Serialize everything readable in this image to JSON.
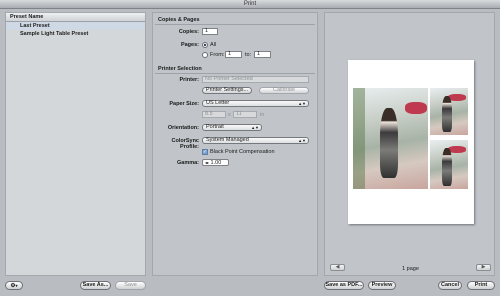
{
  "window": {
    "title": "Print"
  },
  "presets": {
    "header": "Preset Name",
    "items": [
      "Last Preset",
      "Sample Light Table Preset"
    ]
  },
  "copies_pages": {
    "title": "Copies & Pages",
    "copies_label": "Copies:",
    "copies_value": "1",
    "pages_label": "Pages:",
    "all_label": "All",
    "from_label": "From:",
    "from_value": "1",
    "to_label": "to:",
    "to_value": "1"
  },
  "printer_selection": {
    "title": "Printer Selection",
    "printer_label": "Printer:",
    "printer_value": "No Printer Selected",
    "printer_settings_button": "Printer Settings...",
    "calibrate_button": "Calibrate",
    "paper_size_label": "Paper Size:",
    "paper_size_value": "US Letter",
    "width_value": "8.5",
    "height_value": "11",
    "unit_label": "in",
    "orientation_label": "Orientation:",
    "orientation_value": "Portrait",
    "colorsync_label": "ColorSync Profile:",
    "colorsync_value": "System Managed",
    "bpc_label": "Black Point Compensation",
    "bpc_checked": true,
    "gamma_label": "Gamma:",
    "gamma_value": "1.00"
  },
  "preview": {
    "prev_glyph": "◀",
    "next_glyph": "▶",
    "page_count": "1 page"
  },
  "bottom": {
    "gear_glyph": "⚙",
    "save_as_button": "Save As...",
    "save_button": "Save",
    "save_pdf_button": "Save as PDF...",
    "preview_button": "Preview",
    "cancel_button": "Cancel",
    "print_button": "Print"
  }
}
